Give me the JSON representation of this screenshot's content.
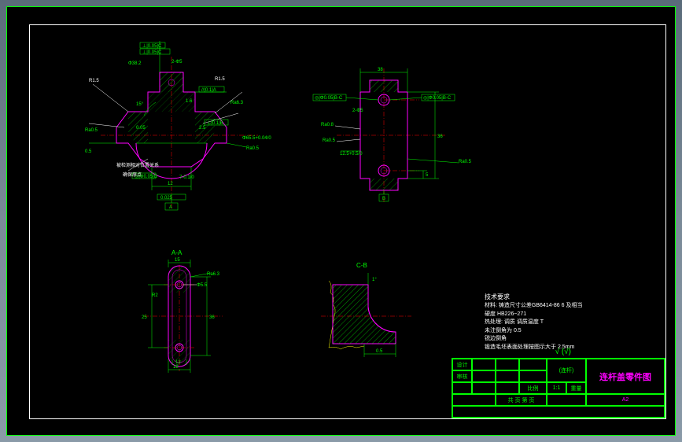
{
  "titleBlock": {
    "mainTitle": "连杆盖零件图",
    "subTitle": "(连杆)",
    "scale": "1:1",
    "number": "A2",
    "fields": {
      "a1": "设计",
      "a2": "",
      "a3": "",
      "a4": "",
      "a5": "",
      "b1": "审核",
      "b2": "",
      "b3": "",
      "b4": "",
      "b5": "",
      "c1": "",
      "c2": "",
      "c3": "",
      "c4": "比例",
      "c5": "重量",
      "d1": "",
      "d2": "",
      "d3": "",
      "d4": "",
      "d5": "共 页 第 页"
    }
  },
  "techNotes": {
    "title": "技术要求",
    "line1": "材料: 铸造尺寸公差GB6414-86    6 及相当",
    "line2": "硬度 HB226~271",
    "line3": "热处理: 调质 调质温度 T",
    "line4": "未注倒角为 0.5",
    "line5": "锐边倒角",
    "line6": "锻造毛坯表面处理按图示大于 2.5mm"
  },
  "surfaceFinish": "√ (√)",
  "views": {
    "main": {
      "dims": {
        "d1": "Φ38.2",
        "d2": "Φ65.5+0.04/0",
        "d3": "R1.5",
        "d4": "R1.5",
        "d5": "1.6",
        "d6": "Ra6.3",
        "d7": "Ra0.5",
        "d8": "Ra0.5",
        "d9": "0.5",
        "d10": "2.5",
        "d11": "0.05",
        "d12": "15°",
        "d13": "12",
        "d14": "2-Φ5",
        "d15": "0.025",
        "d16": "7-0.1/0",
        "d17": "A"
      },
      "gdAndT": {
        "f1": "⊥|0.05|C",
        "f2": "⊥|0.05|C",
        "f3": "//|0.1|A",
        "f4": "⊥|0.1|B",
        "f5": "◎|Φ0.05|D"
      },
      "labels": {
        "l1": "被检测相对位置关系",
        "l2": "确保原点"
      }
    },
    "right": {
      "dims": {
        "d1": "38",
        "d2": "12.5+0.5/0",
        "d3": "Ra0.8",
        "d4": "Ra0.5",
        "d5": "Ra0.5",
        "d6": "36",
        "d7": "5",
        "d8": "B",
        "d9": "2-Φ5"
      },
      "gdAndT": {
        "f1": "◎|Φ0.05|B-C",
        "f2": "◎|Φ0.05|B-C"
      }
    },
    "bottomLeft": {
      "label": "A-A",
      "dims": {
        "d1": "Φ5.5",
        "d2": "Ra6.3",
        "d3": "15",
        "d4": "18",
        "d5": "25",
        "d6": "12",
        "d7": "R2",
        "d8": "36"
      }
    },
    "bottomCenter": {
      "label": "C-B",
      "dims": {
        "d1": "1°",
        "d2": "0.5"
      }
    }
  },
  "colors": {
    "part": "#ff00ff",
    "dim": "#00ff00",
    "center": "#ff0000",
    "text": "#ffffff",
    "frame": "#00ff00",
    "bg": "#000000"
  }
}
